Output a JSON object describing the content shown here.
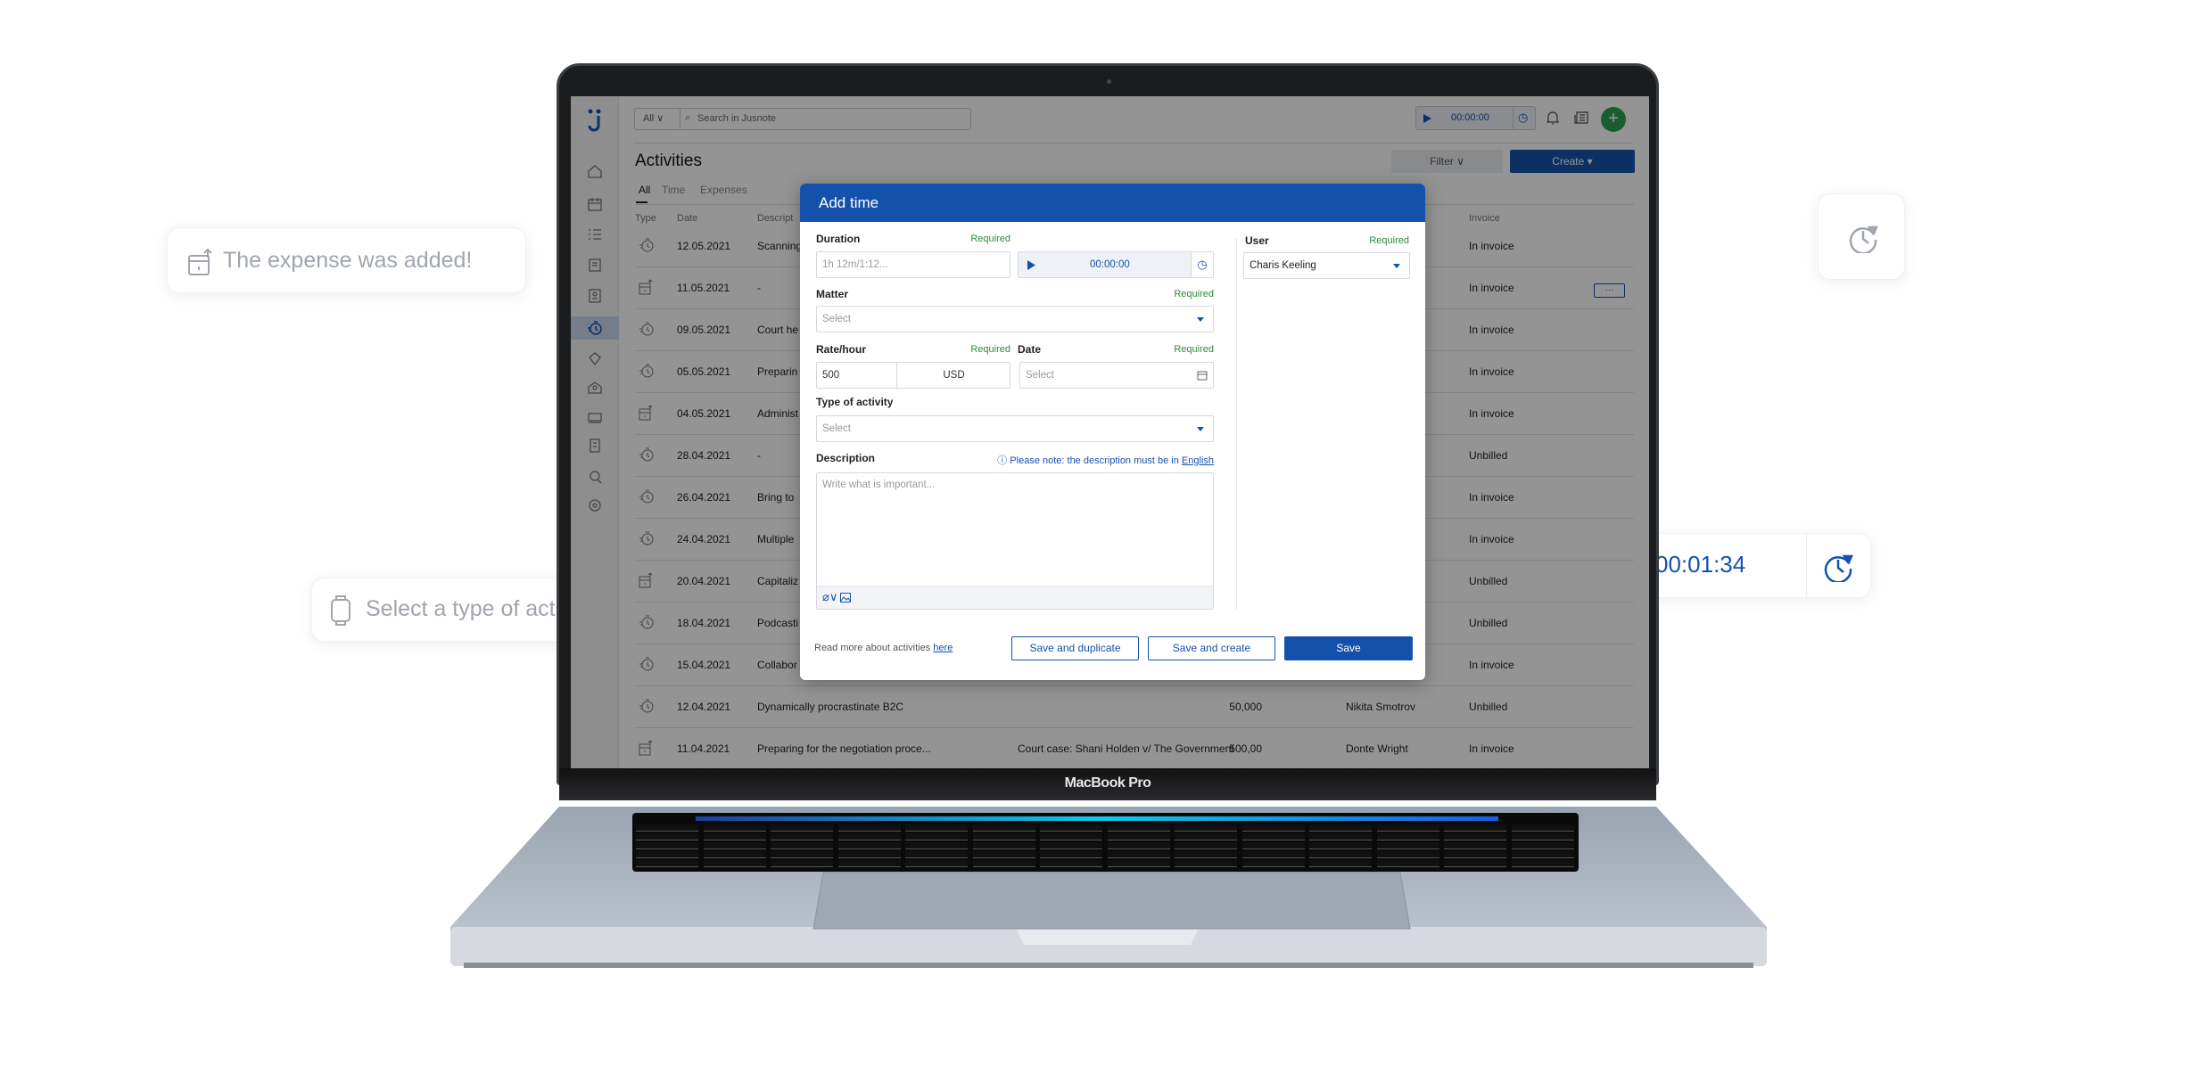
{
  "toasts": {
    "expense_added": "The expense was added!",
    "select_type": "Select a type of activity"
  },
  "timer_card": {
    "time": "00:01:34"
  },
  "laptop": {
    "brand": "MacBook Pro"
  },
  "app": {
    "search": {
      "scope": "All",
      "placeholder": "Search in Jusnote"
    },
    "timer": "00:00:00",
    "page_title": "Activities",
    "filter_label": "Filter",
    "create_label": "Create",
    "tabs": [
      "All",
      "Time",
      "Expenses"
    ],
    "columns": {
      "type": "Type",
      "date": "Date",
      "description": "Descript",
      "invoice": "Invoice"
    },
    "more_label": "···",
    "rows": [
      {
        "type": "time",
        "date": "12.05.2021",
        "description": "Scanning",
        "matter": "",
        "amount": "",
        "user": "",
        "invoice": "In invoice"
      },
      {
        "type": "expense",
        "date": "11.05.2021",
        "description": "-",
        "matter": "",
        "amount": "",
        "user": "",
        "invoice": "In invoice"
      },
      {
        "type": "time",
        "date": "09.05.2021",
        "description": "Court he",
        "matter": "",
        "amount": "",
        "user": "",
        "invoice": "In invoice"
      },
      {
        "type": "time",
        "date": "05.05.2021",
        "description": "Preparin",
        "matter": "",
        "amount": "",
        "user": "",
        "invoice": "In invoice"
      },
      {
        "type": "expense",
        "date": "04.05.2021",
        "description": "Administ",
        "matter": "",
        "amount": "",
        "user": "",
        "invoice": "In invoice"
      },
      {
        "type": "time",
        "date": "28.04.2021",
        "description": "-",
        "matter": "",
        "amount": "",
        "user": "",
        "invoice": "Unbilled"
      },
      {
        "type": "time",
        "date": "26.04.2021",
        "description": "Bring to",
        "matter": "",
        "amount": "",
        "user": "",
        "invoice": "In invoice"
      },
      {
        "type": "time",
        "date": "24.04.2021",
        "description": "Multiple",
        "matter": "",
        "amount": "",
        "user": "",
        "invoice": "In invoice"
      },
      {
        "type": "expense",
        "date": "20.04.2021",
        "description": "Capitaliz",
        "matter": "",
        "amount": "",
        "user": "",
        "invoice": "Unbilled"
      },
      {
        "type": "time",
        "date": "18.04.2021",
        "description": "Podcasti",
        "matter": "",
        "amount": "",
        "user": "",
        "invoice": "Unbilled"
      },
      {
        "type": "time",
        "date": "15.04.2021",
        "description": "Collabor",
        "matter": "",
        "amount": "",
        "user": "",
        "invoice": "In invoice"
      },
      {
        "type": "time",
        "date": "12.04.2021",
        "description": "Dynamically procrastinate B2C",
        "matter": "-",
        "amount": "50,000",
        "user": "Nikita Smotrov",
        "invoice": "Unbilled"
      },
      {
        "type": "expense",
        "date": "11.04.2021",
        "description": "Preparing for the negotiation proce...",
        "matter": "Court case: Shani Holden v/ The Government",
        "amount": "500,00",
        "user": "Donte Wright",
        "invoice": "In invoice"
      }
    ]
  },
  "modal": {
    "title": "Add time",
    "required": "Required",
    "duration": {
      "label": "Duration",
      "placeholder": "1h 12m/1:12...",
      "timer": "00:00:00"
    },
    "matter": {
      "label": "Matter",
      "placeholder": "Select"
    },
    "rate": {
      "label": "Rate/hour",
      "value": "500",
      "currency": "USD"
    },
    "date": {
      "label": "Date",
      "placeholder": "Select"
    },
    "activity_type": {
      "label": "Type of activity",
      "placeholder": "Select"
    },
    "description": {
      "label": "Description",
      "note": "Please note: the description must be in",
      "note_link": "English",
      "placeholder": "Write what is important..."
    },
    "user": {
      "label": "User",
      "value": "Charis Keeling"
    },
    "footer": {
      "read_more": "Read more about activities",
      "link": "here"
    },
    "buttons": {
      "save_duplicate": "Save and duplicate",
      "save_create": "Save and create",
      "save": "Save"
    }
  },
  "colors": {
    "brand": "#1451ad",
    "required": "#2e8b3e",
    "add": "#2e9e55"
  }
}
